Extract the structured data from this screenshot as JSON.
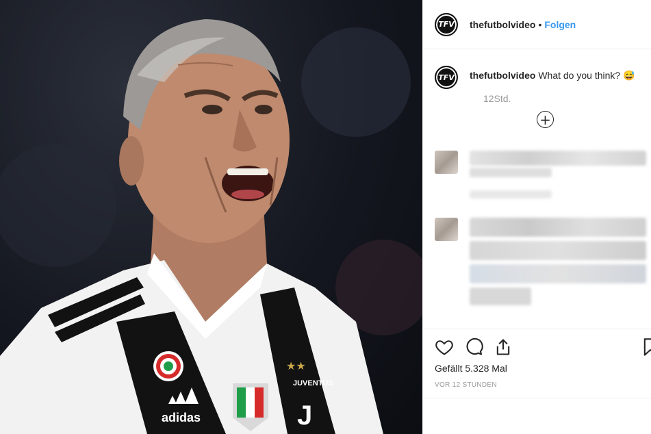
{
  "header": {
    "avatar_text": "TFV",
    "username": "thefutbolvideo",
    "separator": "•",
    "follow_label": "Folgen"
  },
  "caption": {
    "avatar_text": "TFV",
    "username": "thefutbolvideo",
    "text": "What do you think? 😅",
    "time": "12Std."
  },
  "photo": {
    "jersey_text": "JUVENTUS",
    "sponsor_text": "adidas"
  },
  "actions": {
    "likes": "Gefällt 5.328 Mal",
    "timestamp": "VOR 12 STUNDEN"
  },
  "colors": {
    "follow": "#3897f0",
    "text": "#262626",
    "muted": "#999999"
  },
  "icons": [
    "heart-icon",
    "comment-icon",
    "share-icon",
    "bookmark-icon",
    "add-comment-icon"
  ]
}
